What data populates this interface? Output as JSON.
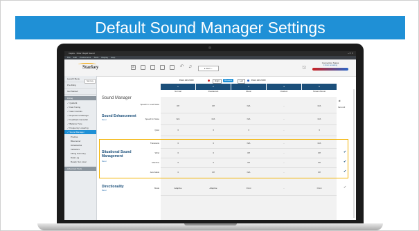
{
  "slide": {
    "title": "Default Sound Manager Settings"
  },
  "app": {
    "titlebar": "Inspire · Fitter: Rapid Sound",
    "window_controls": "– □ ×",
    "menus": [
      "File",
      "Edit",
      "Preferences",
      "Tools",
      "Display",
      "Help"
    ],
    "brand": "Starkey",
    "dropdown_value": "▸ Start ⌄",
    "connection": {
      "title": "Connection Status",
      "sub": "4 hours remaining"
    }
  },
  "sidebar": {
    "tag": "Sub Guy",
    "heads": [
      "Launch Menu",
      "Pre-fitting",
      "Get Started"
    ],
    "group_fitting": "Fitting",
    "checked_items": [
      "QuickFit",
      "Fast Tuning",
      "Gain Controls",
      "Experience Manager",
      "Feedback Canceller",
      "Balance Tune",
      "Frequency Lowering"
    ],
    "active_item": "Sound Manager",
    "sub_items": [
      "Prodina",
      "Bluemoner",
      "Accessories",
      "Indicators",
      "Fitting Summary",
      "Data Log",
      "Ready, Set, Hear"
    ],
    "group_advanced": "Advanced Tools"
  },
  "ears": {
    "left_link": "Ears All 2400",
    "right": "Right",
    "binaural": "Binaural",
    "left": "Left",
    "right_link": "Ears All 2400"
  },
  "main": {
    "title": "Sound Manager",
    "columns": [
      {
        "num": "1",
        "name": "Normal"
      },
      {
        "num": "2",
        "name": "Restaurant"
      },
      {
        "num": "3",
        "name": "Music"
      },
      {
        "num": "4",
        "name": "Outdoor"
      },
      {
        "num": "5",
        "name": "Stream Boost"
      }
    ],
    "sections": [
      {
        "title": "Sound Enhancement",
        "sub": "Reset",
        "rows": [
          {
            "label": "Speech in Loud Noise",
            "cells": [
              "Off",
              "Off",
              "N/A",
              "-",
              "N/A"
            ]
          },
          {
            "label": "Speech in Noise",
            "cells": [
              "N/A",
              "N/A",
              "N/A",
              "-",
              "N/A"
            ]
          },
          {
            "label": "Quiet",
            "cells": [
              "3",
              "3",
              "3",
              "-",
              "3"
            ]
          }
        ]
      },
      {
        "title": "Situational Sound Management",
        "sub": "Reset",
        "rows": [
          {
            "label": "Transients",
            "cells": [
              "3",
              "3",
              "N/A",
              "-",
              "N/A"
            ]
          },
          {
            "label": "Wind",
            "cells": [
              "3",
              "3",
              "Off",
              "-",
              "Off"
            ]
          },
          {
            "label": "Machine",
            "cells": [
              "3",
              "3",
              "Off",
              "-",
              "Off"
            ]
          },
          {
            "label": "Auto Mask",
            "cells": [
              "3",
              "Off",
              "N/A",
              "-",
              "Off"
            ]
          }
        ]
      },
      {
        "title": "Directionality",
        "sub": "Reset",
        "rows": [
          {
            "label": "Mode",
            "cells": [
              "Adaptive",
              "Adaptive",
              "Omni",
              "-",
              "Omni"
            ]
          }
        ]
      }
    ],
    "side_labels": [
      "Set to All"
    ]
  },
  "colors": {
    "accent": "#1f90d6",
    "header": "#1b4f7a",
    "highlight": "#f2b200"
  }
}
